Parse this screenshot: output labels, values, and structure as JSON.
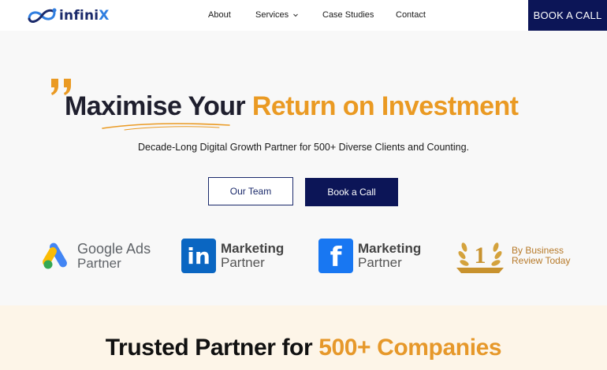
{
  "brand": {
    "name_prefix": "infini",
    "name_suffix": "X"
  },
  "nav": {
    "about": "About",
    "services": "Services",
    "case_studies": "Case Studies",
    "contact": "Contact",
    "book_call": "BOOK A CALL"
  },
  "hero": {
    "title_part1": "Maximise Your",
    "title_part2": "Return on Investment",
    "subtitle": "Decade-Long Digital Growth Partner for 500+ Diverse Clients and Counting.",
    "btn_team": "Our Team",
    "btn_book": "Book a Call"
  },
  "badges": {
    "google": {
      "line1": "Google Ads",
      "line2": "Partner"
    },
    "linkedin": {
      "icon_text": "in",
      "line1": "Marketing",
      "line2": "Partner"
    },
    "facebook": {
      "icon_text": "f",
      "line1": "Marketing",
      "line2": "Partner"
    },
    "award": {
      "rank": "1",
      "line1": "By Business",
      "line2": "Review Today"
    }
  },
  "trusted": {
    "part1": "Trusted Partner for",
    "part2": "500+ Companies"
  },
  "colors": {
    "navy": "#0c1557",
    "accent_orange": "#ea9a23",
    "cream_section": "#fdf5e8",
    "linkedin_blue": "#0a66c2",
    "facebook_blue": "#1877f2"
  }
}
